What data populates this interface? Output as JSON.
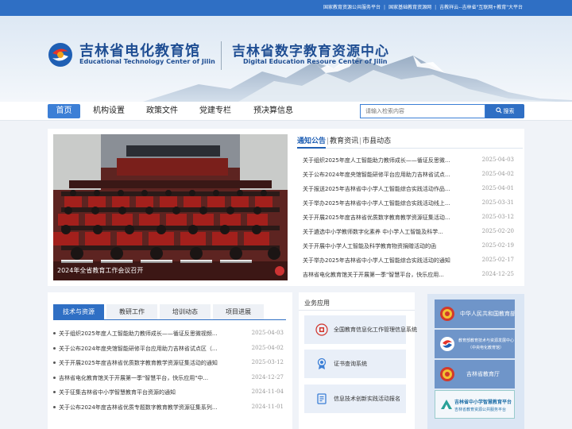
{
  "top_links": [
    "国家教育资源公共服务平台",
    "国家基础教育资源网",
    "吉教祥云--吉林省\"互联网+教育\"大平台"
  ],
  "header": {
    "org_cn": "吉林省电化教育馆",
    "org_en": "Educational Technology Center of Jilin",
    "center_cn": "吉林省数字教育资源中心",
    "center_en": "Digital Education Resoure Center of Jilin"
  },
  "nav": {
    "items": [
      "首页",
      "机构设置",
      "政策文件",
      "党建专栏",
      "预决算信息"
    ],
    "active_index": 0,
    "search_placeholder": "请输入检索内容",
    "search_button": "搜索"
  },
  "slideshow": {
    "caption": "2024年全省教育工作会议召开"
  },
  "news": {
    "tabs": [
      "通知公告",
      "教育资讯",
      "市县动态"
    ],
    "active_tab": 0,
    "items": [
      {
        "title": "关于组织2025年度人工智能助力教师成长——循证反思微...",
        "date": "2025-04-03"
      },
      {
        "title": "关于公布2024年度央馆智能研修平台应用助力吉林省试点...",
        "date": "2025-04-02"
      },
      {
        "title": "关于报送2025年吉林省中小学人工智能综合实践活动作品...",
        "date": "2025-04-01"
      },
      {
        "title": "关于举办2025年吉林省中小学人工智能综合实践活动线上...",
        "date": "2025-03-31"
      },
      {
        "title": "关于开展2025年度吉林省优质数字教育教学资源征集活动...",
        "date": "2025-03-12"
      },
      {
        "title": "关于遴选中小学教师数字化素养 中小学人工智能及科学...",
        "date": "2025-02-20"
      },
      {
        "title": "关于开展中小学人工智能及科学教育物资捐赠活动的函",
        "date": "2025-02-19"
      },
      {
        "title": "关于举办2025年吉林省中小学人工智能综合实践活动的通知",
        "date": "2025-02-17"
      },
      {
        "title": "吉林省电化教育馆关于开展第一季\"智慧平台，快乐应用...",
        "date": "2024-12-25"
      }
    ]
  },
  "resources": {
    "tabs": [
      "技术与资源",
      "教研工作",
      "培训动态",
      "项目进展"
    ],
    "active_tab": 0,
    "items": [
      {
        "title": "关于组织2025年度人工智能助力教师成长——循证反思微视频...",
        "date": "2025-04-03"
      },
      {
        "title": "关于公布2024年度央馆智能研修平台应用助力吉林省试点区（...",
        "date": "2025-04-02"
      },
      {
        "title": "关于开展2025年度吉林省优质数字教育教学资源征集活动的通知",
        "date": "2025-03-12"
      },
      {
        "title": "吉林省电化教育馆关于开展第一季\"智慧平台，快乐应用\"中...",
        "date": "2024-12-27"
      },
      {
        "title": "关于征集吉林省中小学智慧教育平台资源的通知",
        "date": "2024-11-04"
      },
      {
        "title": "关于公布2024年度吉林省优质专题数字教育教学资源征集系列...",
        "date": "2024-11-01"
      }
    ]
  },
  "business": {
    "title": "业务应用",
    "items": [
      {
        "label": "全国教育信息化工作管理信息系统",
        "icon": "management-system-icon"
      },
      {
        "label": "证书查询系统",
        "icon": "certificate-icon"
      },
      {
        "label": "信息技术创新实践活动报名",
        "icon": "registration-icon"
      }
    ]
  },
  "side_links": [
    {
      "label": "中华人民共和国教育部"
    },
    {
      "label": "教育部教育技术与资源发展中心",
      "sub": "（中央电化教育馆）"
    },
    {
      "label": "吉林省教育厅"
    },
    {
      "label": "吉林省中小学智慧教育平台",
      "sub": "吉林省教育资源公共服务平台"
    }
  ],
  "colors": {
    "topbar": "#2f6fc4",
    "accent": "#3c7fd6",
    "brand_text": "#1f4e93"
  }
}
